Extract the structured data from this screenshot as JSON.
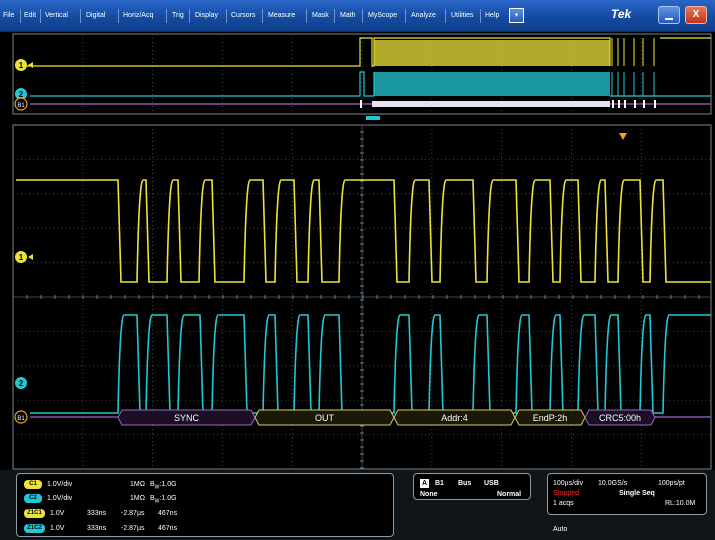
{
  "menu": {
    "items": [
      "File",
      "Edit",
      "Vertical",
      "Digital",
      "Horiz/Acq",
      "Trig",
      "Display",
      "Cursors",
      "Measure",
      "Mask",
      "Math",
      "MyScope",
      "Analyze",
      "Utilities",
      "Help"
    ],
    "dropdown_glyph": "▾",
    "brand": "Tek",
    "close_glyph": "X"
  },
  "colors": {
    "ch1": "#ece33a",
    "ch2": "#22c8d4",
    "bus": "#a066c8",
    "grid": "#3c4a55",
    "trigger": "#f2a324"
  },
  "waveform": {
    "markers": {
      "ch1_top": "1",
      "ch2_top": "2",
      "bus_top": "B1",
      "ch1_main": "1",
      "ch2_main": "2",
      "bus_main": "B1"
    },
    "bus_decode": [
      "SYNC",
      "OUT",
      "Addr:4",
      "EndP:2h",
      "CRC5:00h"
    ]
  },
  "channels": [
    {
      "chip": "C1",
      "scale": "1.0V/div",
      "coupling": "1MΩ",
      "bw": "B",
      "bw_sub": "W",
      "bw_val": ":1.0G",
      "chip_color": "#ece33a"
    },
    {
      "chip": "C2",
      "scale": "1.0V/div",
      "coupling": "1MΩ",
      "bw": "B",
      "bw_sub": "W",
      "bw_val": ":1.0G",
      "chip_color": "#22c8d4"
    }
  ],
  "zooms": [
    {
      "chip": "Z1C1",
      "scale": "1.0V",
      "pos": "333ns",
      "offset": "-2.87µs",
      "width": "467ns",
      "chip_color": "#ece33a"
    },
    {
      "chip": "Z1C2",
      "scale": "1.0V",
      "pos": "333ns",
      "offset": "-2.87µs",
      "width": "467ns",
      "chip_color": "#22c8d4"
    }
  ],
  "bus_panel": {
    "badge": "A",
    "bus": "B1",
    "label": "Bus",
    "protocol": "USB",
    "source": "None",
    "mode": "Normal"
  },
  "acq_panel": {
    "horiz": "100µs/div",
    "rate": "10.0GS/s",
    "resolution": "100ps/pt",
    "state": "Stopped",
    "seq": "Single Seq",
    "acqs": "1 acqs",
    "rl": "RL:10.0M",
    "trigger_mode": "Auto"
  }
}
